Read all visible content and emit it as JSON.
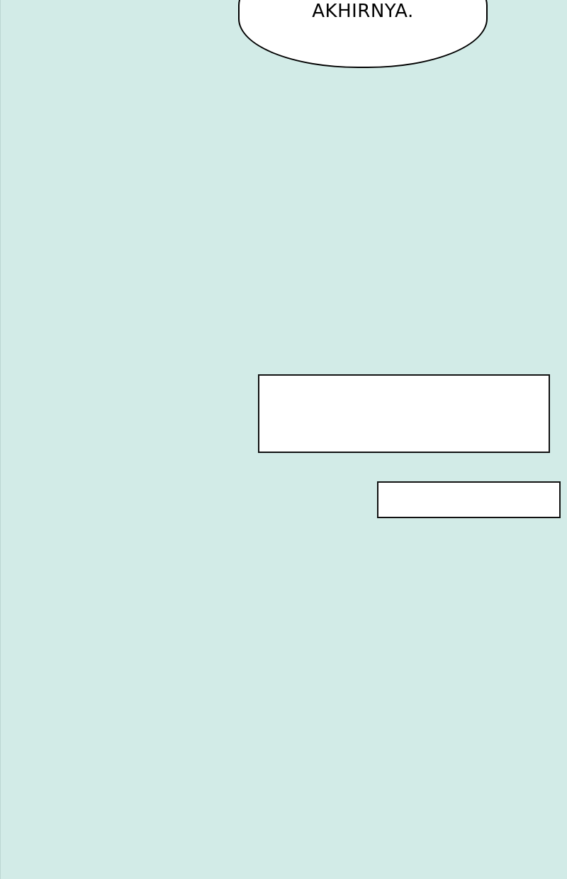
{
  "panel": {
    "background_color": "#d2ebe7"
  },
  "speech_bubble": {
    "text": "AKHIRNYA."
  },
  "caption_boxes": [
    {
      "text": ""
    },
    {
      "text": ""
    }
  ]
}
